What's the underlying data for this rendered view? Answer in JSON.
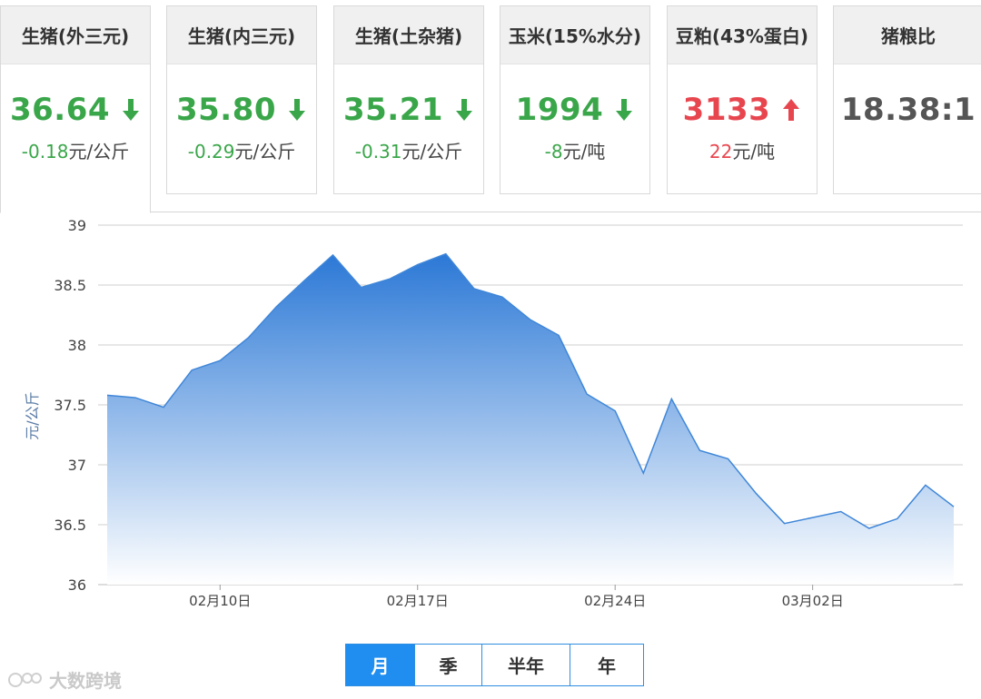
{
  "cards": [
    {
      "title": "生猪(外三元)",
      "value": "36.64",
      "change_num": "-0.18",
      "change_unit": "元/公斤",
      "trend": "down",
      "active": true
    },
    {
      "title": "生猪(内三元)",
      "value": "35.80",
      "change_num": "-0.29",
      "change_unit": "元/公斤",
      "trend": "down",
      "active": false
    },
    {
      "title": "生猪(土杂猪)",
      "value": "35.21",
      "change_num": "-0.31",
      "change_unit": "元/公斤",
      "trend": "down",
      "active": false
    },
    {
      "title": "玉米(15%水分)",
      "value": "1994",
      "change_num": "-8",
      "change_unit": "元/吨",
      "trend": "down",
      "active": false
    },
    {
      "title": "豆粕(43%蛋白)",
      "value": "3133",
      "change_num": "22",
      "change_unit": "元/吨",
      "trend": "up",
      "active": false
    },
    {
      "title": "猪粮比",
      "value": "18.38:1",
      "change_num": "",
      "change_unit": "",
      "trend": "neutral",
      "active": false
    }
  ],
  "colors": {
    "down": "#3aa64a",
    "up": "#e8464f",
    "accent": "#1f8ef0",
    "line": "#3f86d8",
    "area_top": "#2b78d6",
    "area_bottom": "#ffffff",
    "grid": "#cfcfcf",
    "axis_label": "#5b7da6"
  },
  "chart_data": {
    "type": "area",
    "ylabel": "元/公斤",
    "ylim": [
      36,
      39
    ],
    "yticks": [
      36,
      36.5,
      37,
      37.5,
      38,
      38.5,
      39
    ],
    "xtick_labels": [
      {
        "label": "02月10日",
        "index": 4
      },
      {
        "label": "02月17日",
        "index": 11
      },
      {
        "label": "02月24日",
        "index": 18
      },
      {
        "label": "03月02日",
        "index": 25
      }
    ],
    "grid": true,
    "values": [
      37.58,
      37.56,
      37.48,
      37.79,
      37.87,
      38.06,
      38.32,
      38.54,
      38.75,
      38.48,
      38.55,
      38.67,
      38.76,
      38.47,
      38.4,
      38.21,
      38.08,
      37.59,
      37.45,
      36.93,
      37.55,
      37.12,
      37.05,
      36.76,
      36.51,
      36.56,
      36.61,
      36.47,
      36.55,
      36.83,
      36.65
    ]
  },
  "range_buttons": [
    {
      "label": "月",
      "active": true
    },
    {
      "label": "季",
      "active": false
    },
    {
      "label": "半年",
      "active": false
    },
    {
      "label": "年",
      "active": false
    }
  ],
  "watermark": "大数跨境"
}
